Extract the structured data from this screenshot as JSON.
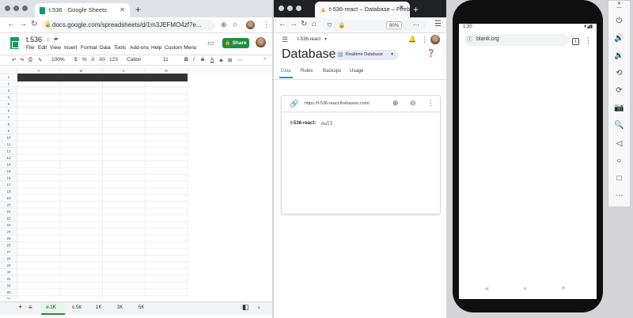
{
  "sheets_window": {
    "tab_title": "t.536 - Google Sheets",
    "url": "docs.google.com/spreadsheets/d/1m3JEFMO4zf7e...",
    "doc_title": "t.536",
    "menu": [
      "File",
      "Edit",
      "View",
      "Insert",
      "Format",
      "Data",
      "Tools",
      "Add-ons",
      "Help",
      "Custom Menu"
    ],
    "share_label": "Share",
    "toolbar": {
      "zoom": "100%",
      "currency": "$",
      "percent": "%",
      "decimal_dec": ".0",
      "decimal_inc": ".00",
      "format": "123",
      "font": "Calibri",
      "size": "11",
      "bold": "B",
      "italic": "I",
      "strike": "S",
      "text_color": "A"
    },
    "columns": [
      "A",
      "B",
      "C",
      "D"
    ],
    "rows": [
      "1",
      "2",
      "3",
      "4",
      "5",
      "6",
      "7",
      "8",
      "9",
      "10",
      "11",
      "12",
      "13",
      "14",
      "15",
      "16",
      "17",
      "18",
      "19",
      "20",
      "21",
      "22",
      "23",
      "24",
      "25",
      "26",
      "27",
      "28",
      "29",
      "30",
      "31",
      "32",
      "33",
      "34"
    ],
    "sheet_tabs": [
      "o.1K",
      "o.5K",
      "1K",
      "3K",
      "5K"
    ],
    "active_sheet": "o.1K"
  },
  "firebase_window": {
    "tab_title": "t-536-react – Database – Fireba",
    "zoom": "80%",
    "project": "t-536-react",
    "page_title": "Database",
    "db_type": "Realtime Database",
    "tabs": [
      "Data",
      "Rules",
      "Backups",
      "Usage"
    ],
    "active_tab": "Data",
    "db_url": "https://t-536-react.firebaseio.com/",
    "node_key": "t-536-react:",
    "node_value": "null"
  },
  "android": {
    "time": "1:30",
    "url": "blank.org",
    "tab_count": "1"
  },
  "colors": {
    "sheets_green": "#0f9d58",
    "share_green": "#1e8e3e",
    "firebase_blue": "#039be5",
    "row1_fill": "#333333"
  }
}
